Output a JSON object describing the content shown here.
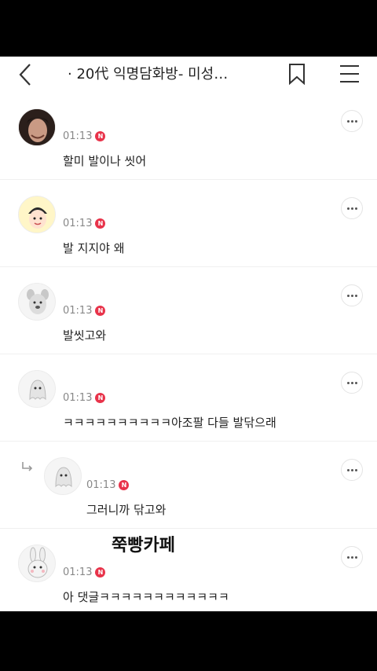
{
  "header": {
    "title": "· 20代 익명담화방- 미성…"
  },
  "comments": [
    {
      "time": "01:13",
      "badge": "N",
      "text": "할미 발이나 씻어",
      "avatar": "man-photo-avatar"
    },
    {
      "time": "01:13",
      "badge": "N",
      "text": "발 지지야 왜",
      "avatar": "cartoon-boy-avatar"
    },
    {
      "time": "01:13",
      "badge": "N",
      "text": "발씻고와",
      "avatar": "dog-character-avatar"
    },
    {
      "time": "01:13",
      "badge": "N",
      "text": "ㅋㅋㅋㅋㅋㅋㅋㅋㅋㅋ아조팔 다들 발닦으래",
      "avatar": "ghost-character-avatar"
    },
    {
      "time": "01:13",
      "badge": "N",
      "text": "그러니까 닦고와",
      "avatar": "ghost-character-avatar"
    },
    {
      "time": "01:13",
      "badge": "N",
      "text": "아 댓글ㅋㅋㅋㅋㅋㅋㅋㅋㅋㅋㅋㅋ",
      "avatar": "bunny-character-avatar"
    }
  ],
  "watermark": "쭉빵카페"
}
